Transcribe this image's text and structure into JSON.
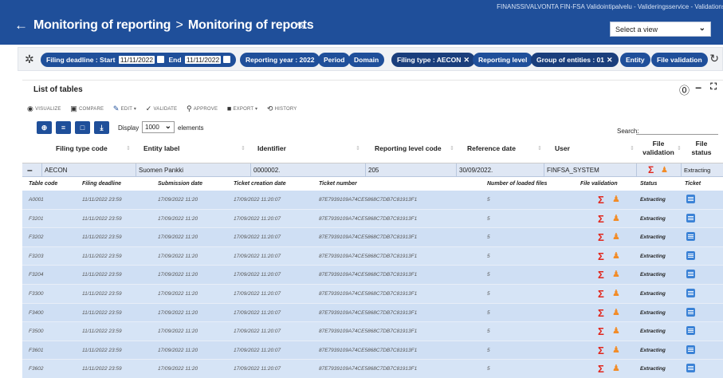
{
  "header": {
    "org": "FINANSSIVALVONTA FIN-FSA Validointipalvelu - Valideringsservice - Validationser",
    "back_glyph": "←",
    "breadcrumb_1": "Monitoring of reporting",
    "breadcrumb_sep": ">",
    "breadcrumb_2": "Monitoring of reports",
    "view_select": "Select a view"
  },
  "filters": {
    "filing_deadline_label": "Filing deadline : Start",
    "start_date": "11/11/2022",
    "end_label": "End",
    "end_date": "11/11/2022",
    "reporting_year": "Reporting year : 2022",
    "period": "Period",
    "domain": "Domain",
    "filing_type": "Filing type : AECON",
    "reporting_level": "Reporting level",
    "group_of_entities": "Group of entities : 01",
    "entity": "Entity",
    "file_validation": "File validation"
  },
  "panel": {
    "title": "List of tables",
    "actions": [
      "Visualize",
      "Compare",
      "Edit",
      "Validate",
      "Approve",
      "Export",
      "History"
    ],
    "display_label": "Display",
    "display_value": "1000",
    "elements_label": "elements",
    "search_label": "Search:"
  },
  "main_headers": {
    "filing_type_code": "Filing type code",
    "entity_label": "Entity label",
    "identifier": "Identifier",
    "reporting_level_code": "Reporting level code",
    "reference_date": "Reference date",
    "user": "User",
    "file_validation": "File validation",
    "file_status": "File status"
  },
  "group_row": {
    "filing_type_code": "AECON",
    "entity_label": "Suomen Pankki",
    "identifier": "0000002.",
    "reporting_level_code": "205",
    "reference_date": "30/09/2022.",
    "user": "FINFSA_SYSTEM",
    "file_status": "Extracting"
  },
  "sub_headers": {
    "table_code": "Table code",
    "filing_deadline": "Filing deadline",
    "submission_date": "Submission date",
    "ticket_creation_date": "Ticket creation date",
    "ticket_number": "Ticket number",
    "number_of_loaded_files": "Number of loaded files",
    "file_validation": "File validation",
    "status": "Status",
    "ticket": "Ticket"
  },
  "rows": [
    {
      "code": "A0001",
      "deadline": "11/11/2022 23:59",
      "submission": "17/09/2022 11:20",
      "created": "17/09/2022 11:20:07",
      "ticket": "87E7939109A74CE5868C7DB7C81913F1",
      "files": "5",
      "status": "Extracting"
    },
    {
      "code": "F3201",
      "deadline": "11/11/2022 23:59",
      "submission": "17/09/2022 11:20",
      "created": "17/09/2022 11:20:07",
      "ticket": "87E7939109A74CE5868C7DB7C81913F1",
      "files": "5",
      "status": "Extracting"
    },
    {
      "code": "F3202",
      "deadline": "11/11/2022 23:59",
      "submission": "17/09/2022 11:20",
      "created": "17/09/2022 11:20:07",
      "ticket": "87E7939109A74CE5868C7DB7C81913F1",
      "files": "5",
      "status": "Extracting"
    },
    {
      "code": "F3203",
      "deadline": "11/11/2022 23:59",
      "submission": "17/09/2022 11:20",
      "created": "17/09/2022 11:20:07",
      "ticket": "87E7939109A74CE5868C7DB7C81913F1",
      "files": "5",
      "status": "Extracting"
    },
    {
      "code": "F3204",
      "deadline": "11/11/2022 23:59",
      "submission": "17/09/2022 11:20",
      "created": "17/09/2022 11:20:07",
      "ticket": "87E7939109A74CE5868C7DB7C81913F1",
      "files": "5",
      "status": "Extracting"
    },
    {
      "code": "F3300",
      "deadline": "11/11/2022 23:59",
      "submission": "17/09/2022 11:20",
      "created": "17/09/2022 11:20:07",
      "ticket": "87E7939109A74CE5868C7DB7C81913F1",
      "files": "5",
      "status": "Extracting"
    },
    {
      "code": "F3400",
      "deadline": "11/11/2022 23:59",
      "submission": "17/09/2022 11:20",
      "created": "17/09/2022 11:20:07",
      "ticket": "87E7939109A74CE5868C7DB7C81913F1",
      "files": "5",
      "status": "Extracting"
    },
    {
      "code": "F3500",
      "deadline": "11/11/2022 23:59",
      "submission": "17/09/2022 11:20",
      "created": "17/09/2022 11:20:07",
      "ticket": "87E7939109A74CE5868C7DB7C81913F1",
      "files": "5",
      "status": "Extracting"
    },
    {
      "code": "F3601",
      "deadline": "11/11/2022 23:59",
      "submission": "17/09/2022 11:20",
      "created": "17/09/2022 11:20:07",
      "ticket": "87E7939109A74CE5868C7DB7C81913F1",
      "files": "5",
      "status": "Extracting"
    },
    {
      "code": "F3602",
      "deadline": "11/11/2022 23:59",
      "submission": "17/09/2022 11:20",
      "created": "17/09/2022 11:20:07",
      "ticket": "87E7939109A74CE5868C7DB7C81913F1",
      "files": "5",
      "status": "Extracting"
    }
  ],
  "colors": {
    "brand": "#1f4f9a",
    "row_bg": "#d6e4f6",
    "error": "#e1261c",
    "warning": "#f28c28"
  },
  "icons": {
    "validation": "sigma-icon",
    "user": "person-icon",
    "ticket": "ticket-icon"
  }
}
